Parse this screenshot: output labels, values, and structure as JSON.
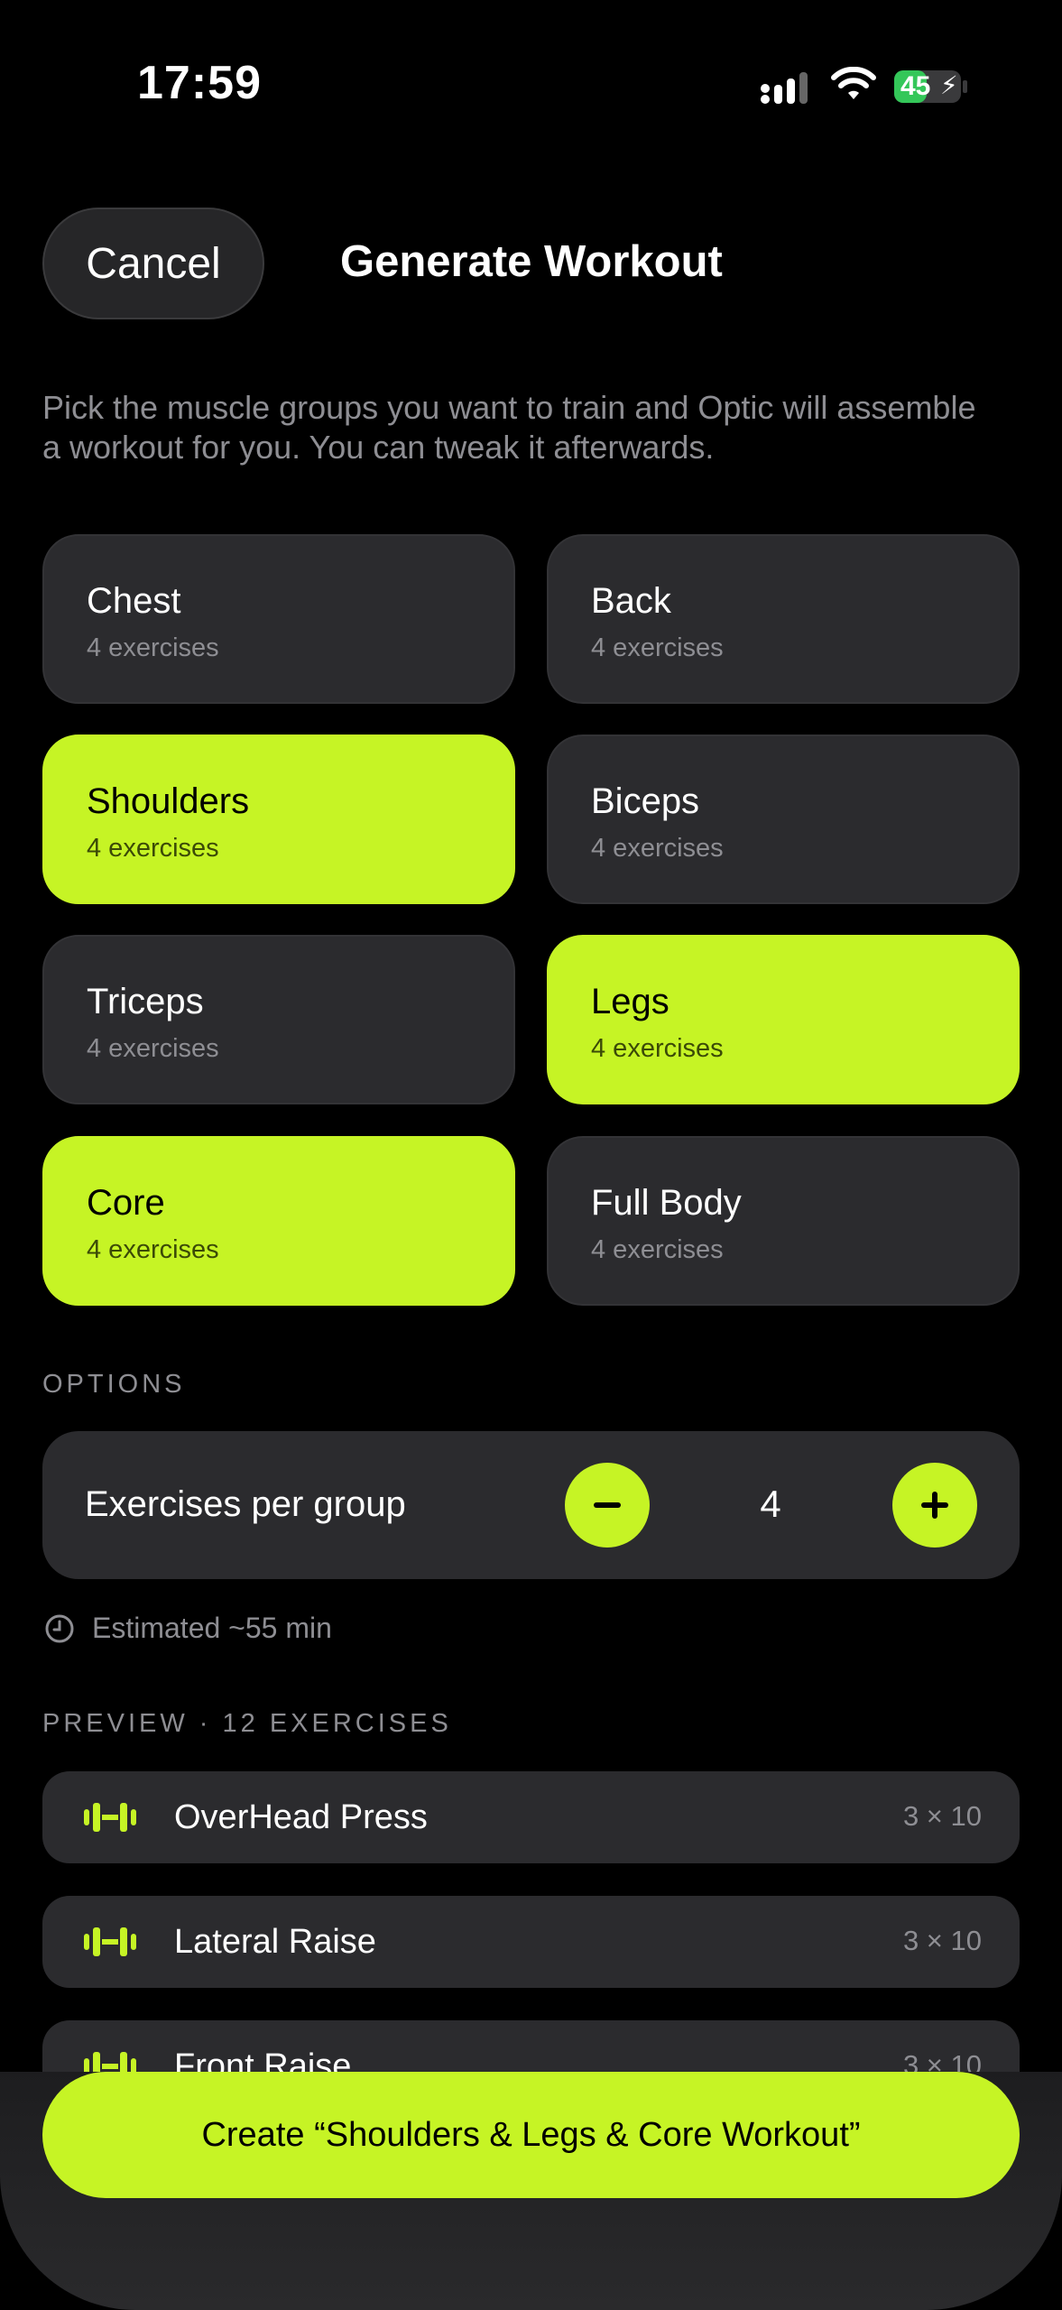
{
  "status_bar": {
    "time": "17:59",
    "battery": "45"
  },
  "header": {
    "cancel_label": "Cancel",
    "title": "Generate Workout"
  },
  "description": "Pick the muscle groups you want to train and Optic will assemble a workout for you. You can tweak it afterwards.",
  "muscle_groups": [
    {
      "name": "Chest",
      "count": "4 exercises",
      "selected": false
    },
    {
      "name": "Back",
      "count": "4 exercises",
      "selected": false
    },
    {
      "name": "Shoulders",
      "count": "4 exercises",
      "selected": true
    },
    {
      "name": "Biceps",
      "count": "4 exercises",
      "selected": false
    },
    {
      "name": "Triceps",
      "count": "4 exercises",
      "selected": false
    },
    {
      "name": "Legs",
      "count": "4 exercises",
      "selected": true
    },
    {
      "name": "Core",
      "count": "4 exercises",
      "selected": true
    },
    {
      "name": "Full Body",
      "count": "4 exercises",
      "selected": false
    }
  ],
  "options": {
    "section_label": "OPTIONS",
    "exercises_per_group_label": "Exercises per group",
    "exercises_per_group_value": "4",
    "estimate": "Estimated ~55 min"
  },
  "preview": {
    "section_label": "PREVIEW · 12 EXERCISES",
    "exercises": [
      {
        "name": "OverHead Press",
        "sets": "3 × 10"
      },
      {
        "name": "Lateral Raise",
        "sets": "3 × 10"
      },
      {
        "name": "Front Raise",
        "sets": "3 × 10"
      }
    ]
  },
  "create_button_label": "Create “Shoulders & Legs & Core Workout”",
  "colors": {
    "accent": "#c6f425",
    "background": "#000000",
    "card": "#2b2b2e",
    "muted_text": "#8e8e93"
  }
}
